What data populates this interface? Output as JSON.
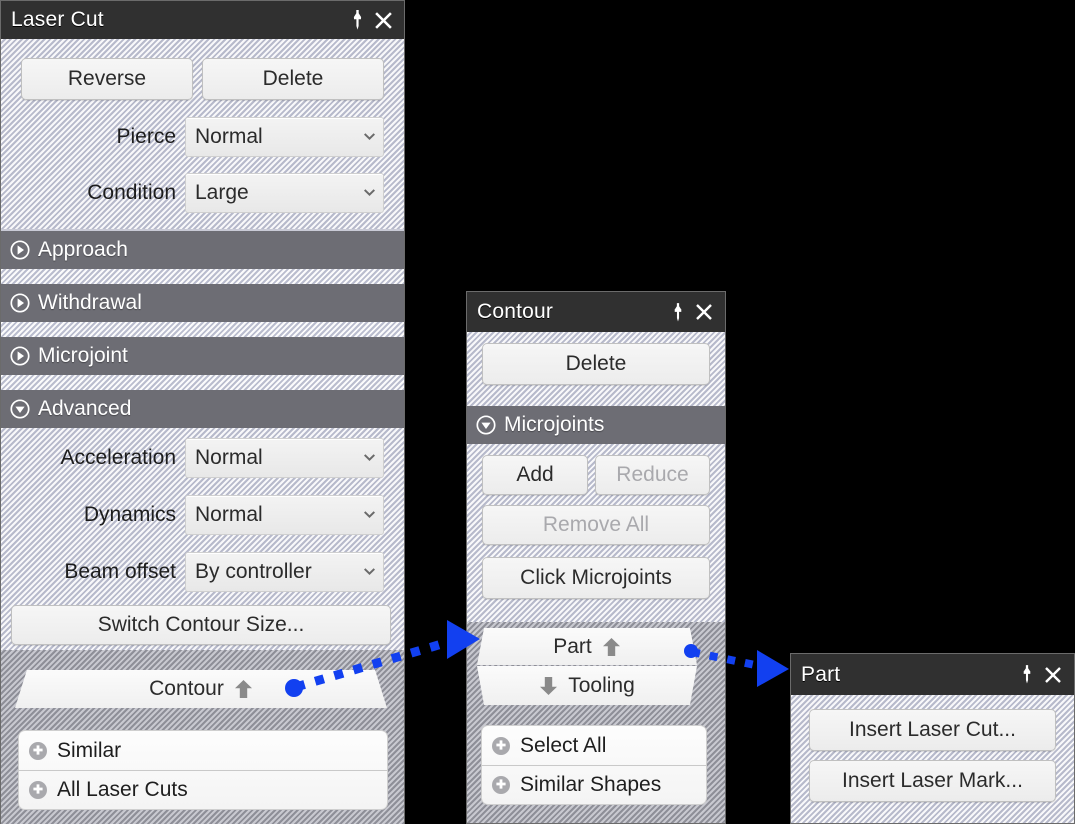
{
  "laser_cut_panel": {
    "title": "Laser Cut",
    "pin_icon": "pin-icon",
    "close_icon": "close-icon",
    "buttons": [
      {
        "label": "Reverse",
        "enabled": true
      },
      {
        "label": "Delete",
        "enabled": true
      }
    ],
    "fields": [
      {
        "label": "Pierce",
        "value": "Normal",
        "icon": "chevron-down-icon"
      },
      {
        "label": "Condition",
        "value": "Large",
        "icon": "chevron-down-icon"
      }
    ],
    "sections": [
      {
        "label": "Approach",
        "expanded": false,
        "icon": "collapsed-arrow-icon"
      },
      {
        "label": "Withdrawal",
        "expanded": false,
        "icon": "collapsed-arrow-icon"
      },
      {
        "label": "Microjoint",
        "expanded": false,
        "icon": "collapsed-arrow-icon"
      },
      {
        "label": "Advanced",
        "expanded": true,
        "icon": "expanded-arrow-icon"
      }
    ],
    "advanced_fields": [
      {
        "label": "Acceleration",
        "value": "Normal",
        "icon": "chevron-down-icon"
      },
      {
        "label": "Dynamics",
        "value": "Normal",
        "icon": "chevron-down-icon"
      },
      {
        "label": "Beam offset",
        "value": "By controller",
        "icon": "chevron-down-icon"
      }
    ],
    "switch_button": "Switch Contour Size...",
    "tab": {
      "label": "Contour",
      "icon": "arrow-up-icon"
    },
    "plus_list": [
      {
        "label": "Similar",
        "icon": "plus-circle-icon"
      },
      {
        "label": "All Laser Cuts",
        "icon": "plus-circle-icon"
      }
    ]
  },
  "contour_panel": {
    "title": "Contour",
    "pin_icon": "pin-icon",
    "close_icon": "close-icon",
    "delete_button": "Delete",
    "section": {
      "label": "Microjoints",
      "expanded": true,
      "icon": "expanded-arrow-icon"
    },
    "buttons": [
      {
        "label": "Add",
        "enabled": true
      },
      {
        "label": "Reduce",
        "enabled": false
      },
      {
        "label": "Remove All",
        "enabled": false
      },
      {
        "label": "Click Microjoints",
        "enabled": true
      }
    ],
    "tabs": [
      {
        "label": "Part",
        "icon": "arrow-up-icon",
        "direction": "up"
      },
      {
        "label": "Tooling",
        "icon": "arrow-down-icon",
        "direction": "down"
      }
    ],
    "plus_list": [
      {
        "label": "Select All",
        "icon": "plus-circle-icon"
      },
      {
        "label": "Similar Shapes",
        "icon": "plus-circle-icon"
      }
    ]
  },
  "part_panel": {
    "title": "Part",
    "pin_icon": "pin-icon",
    "close_icon": "close-icon",
    "buttons": [
      {
        "label": "Insert Laser Cut...",
        "enabled": true
      },
      {
        "label": "Insert Laser Mark...",
        "enabled": true
      }
    ]
  },
  "annotations": {
    "arrow_color": "#1240f0",
    "arrows": [
      {
        "from": "laser-cut-contour-tab",
        "to": "contour-panel"
      },
      {
        "from": "contour-part-tab",
        "to": "part-panel"
      }
    ]
  }
}
